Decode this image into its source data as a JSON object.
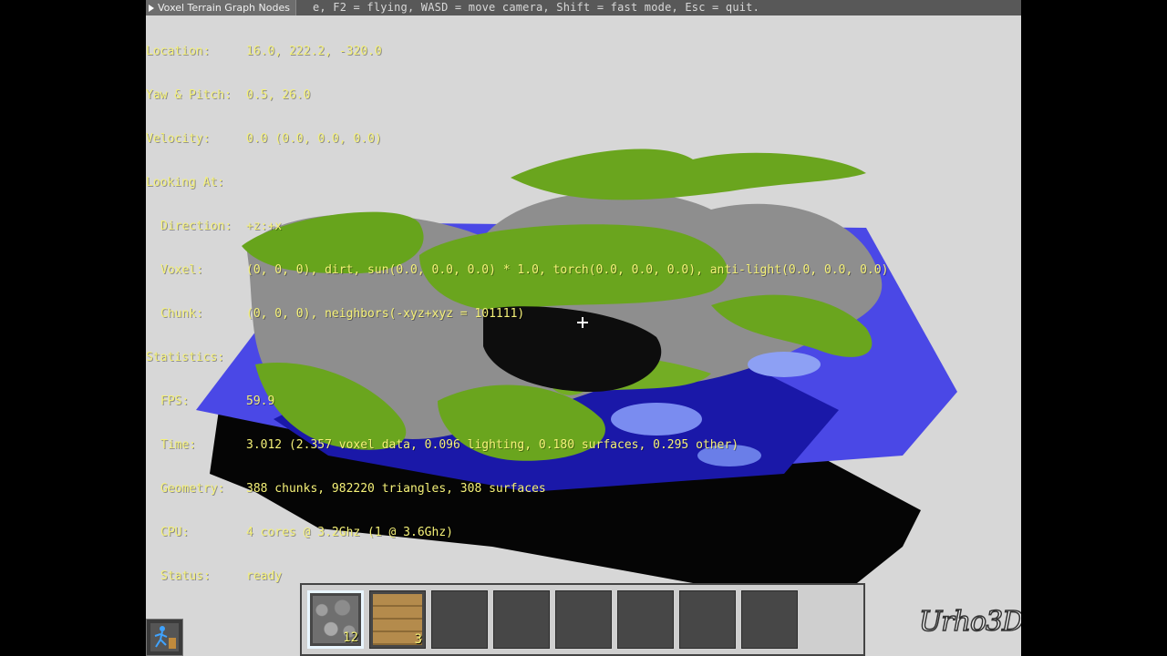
{
  "window": {
    "title": "Voxel Terrain Graph Nodes",
    "hint": "e, F2 = flying, WASD = move camera, Shift = fast mode, Esc = quit."
  },
  "debug": {
    "location": {
      "label": "Location:",
      "value": "16.0, 222.2, -320.0"
    },
    "yaw_pitch": {
      "label": "Yaw & Pitch:",
      "value": "0.5, 26.0"
    },
    "velocity": {
      "label": "Velocity:",
      "value": "0.0 (0.0, 0.0, 0.0)"
    },
    "looking_at": {
      "label": "Looking At:"
    },
    "direction": {
      "label": "Direction:",
      "value": "+z:+x"
    },
    "voxel": {
      "label": "Voxel:",
      "value": "(0, 0, 0), dirt, sun(0.0, 0.0, 0.0) * 1.0, torch(0.0, 0.0, 0.0), anti-light(0.0, 0.0, 0.0)"
    },
    "chunk": {
      "label": "Chunk:",
      "value": "(0, 0, 0), neighbors(-xyz+xyz = 101111)"
    },
    "statistics": {
      "label": "Statistics:"
    },
    "fps": {
      "label": "FPS:",
      "value": "59.9"
    },
    "time": {
      "label": "Time:",
      "value": "3.012 (2.357 voxel data, 0.096 lighting, 0.180 surfaces, 0.295 other)"
    },
    "geometry": {
      "label": "Geometry:",
      "value": "388 chunks, 982220 triangles, 308 surfaces"
    },
    "cpu": {
      "label": "CPU:",
      "value": "4 cores @ 3.2Ghz (1 @ 3.6Ghz)"
    },
    "status": {
      "label": "Status:",
      "value": "ready"
    }
  },
  "hotbar": {
    "slots": [
      {
        "item": "cobblestone",
        "count": "12",
        "selected": true
      },
      {
        "item": "planks",
        "count": "3",
        "selected": false
      },
      {
        "item": "",
        "count": ""
      },
      {
        "item": "",
        "count": ""
      },
      {
        "item": "",
        "count": ""
      },
      {
        "item": "",
        "count": ""
      },
      {
        "item": "",
        "count": ""
      },
      {
        "item": "",
        "count": ""
      }
    ]
  },
  "colors": {
    "viewport_bg": "#d7d7d7",
    "water": "#3f3fd6",
    "grass": "#6aa51e",
    "stone": "#8f8f8f",
    "overlay_text": "#f5f178"
  }
}
